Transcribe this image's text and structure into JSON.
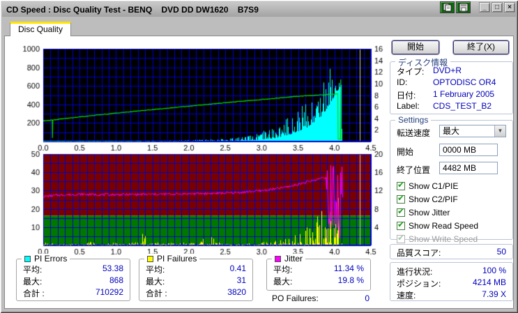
{
  "window": {
    "title": "CD Speed : Disc Quality Test - BENQ    DVD DD DW1620    B7S9"
  },
  "titlebar": {
    "min": "_",
    "max": "□",
    "close": "×"
  },
  "tab": {
    "label": "Disc Quality"
  },
  "actions": {
    "start": "開始",
    "exit": "終了(X)"
  },
  "disc_info": {
    "title": "ディスク情報",
    "rows": [
      {
        "label": "タイプ:",
        "value": "DVD+R"
      },
      {
        "label": "ID:",
        "value": "OPTODISC OR4"
      },
      {
        "label": "日付:",
        "value": "1 February 2005"
      },
      {
        "label": "Label:",
        "value": "CDS_TEST_B2"
      }
    ]
  },
  "settings": {
    "title": "Settings",
    "speed_label": "転送速度",
    "speed_value": "最大",
    "start_label": "開始",
    "start_value": "0000 MB",
    "end_label": "終了位置",
    "end_value": "4482 MB",
    "checkboxes": [
      {
        "label": "Show C1/PIE",
        "checked": true,
        "enabled": true
      },
      {
        "label": "Show C2/PIF",
        "checked": true,
        "enabled": true
      },
      {
        "label": "Show Jitter",
        "checked": true,
        "enabled": true
      },
      {
        "label": "Show Read Speed",
        "checked": true,
        "enabled": true
      },
      {
        "label": "Show Write Speed",
        "checked": true,
        "enabled": false
      }
    ]
  },
  "quality": {
    "label": "品質スコア:",
    "value": "50"
  },
  "progress": {
    "rows": [
      {
        "label": "進行状況:",
        "value": "100 %"
      },
      {
        "label": "ポジション:",
        "value": "4214 MB"
      },
      {
        "label": "速度:",
        "value": "7.39 X"
      }
    ]
  },
  "legends": [
    {
      "title": "PI Errors",
      "color": "#00ffff",
      "rows": [
        {
          "label": "平均:",
          "value": "53.38"
        },
        {
          "label": "最大:",
          "value": "868"
        },
        {
          "label": "合計 :",
          "value": "710292"
        }
      ]
    },
    {
      "title": "PI Failures",
      "color": "#ffff00",
      "rows": [
        {
          "label": "平均:",
          "value": "0.41"
        },
        {
          "label": "最大:",
          "value": "31"
        },
        {
          "label": "合計 :",
          "value": "3820"
        }
      ]
    },
    {
      "title": "Jitter",
      "color": "#ff00ff",
      "rows": [
        {
          "label": "平均:",
          "value": "11.34 %"
        },
        {
          "label": "最大:",
          "value": "19.8 %"
        }
      ]
    }
  ],
  "po_failures": {
    "label": "PO Failures:",
    "value": "0"
  },
  "chart_data": [
    {
      "type": "area",
      "title": "PI Errors / Read Speed",
      "x_range": [
        0,
        4.5
      ],
      "x_ticks": [
        "0.0",
        "0.5",
        "1.0",
        "1.5",
        "2.0",
        "2.5",
        "3.0",
        "3.5",
        "4.0",
        "4.5"
      ],
      "x_minor_step": 0.1,
      "background": "#000000",
      "grid_color": "#0000cc",
      "grid_divisions": 10,
      "left_axis": {
        "range": [
          0,
          1000
        ],
        "tick_labels": [
          "200",
          "400",
          "600",
          "800",
          "1000"
        ],
        "tick_values": [
          200,
          400,
          600,
          800,
          1000
        ]
      },
      "right_axis": {
        "range": [
          0,
          16
        ],
        "tick_labels": [
          "2",
          "4",
          "6",
          "8",
          "10",
          "12",
          "14",
          "16"
        ],
        "tick_values": [
          2,
          4,
          6,
          8,
          10,
          12,
          14,
          16
        ]
      },
      "cursor_x": 4.35,
      "cursor_color": "#c8c8c8",
      "series": [
        {
          "name": "PI Errors",
          "kind": "spikes",
          "color": "#00ffff",
          "axis": "left",
          "seed": 11,
          "base": [
            [
              0,
              1
            ],
            [
              1.0,
              2
            ],
            [
              1.5,
              3
            ],
            [
              2.0,
              5
            ],
            [
              2.5,
              8
            ],
            [
              2.8,
              12
            ],
            [
              3.0,
              20
            ],
            [
              3.2,
              40
            ],
            [
              3.4,
              80
            ],
            [
              3.6,
              140
            ],
            [
              3.8,
              260
            ],
            [
              3.9,
              360
            ],
            [
              3.95,
              430
            ],
            [
              4.0,
              500
            ],
            [
              4.05,
              560
            ],
            [
              4.09,
              600
            ],
            [
              4.1,
              0
            ]
          ],
          "peak": [
            [
              0,
              4
            ],
            [
              0.5,
              5
            ],
            [
              1.0,
              6
            ],
            [
              1.5,
              9
            ],
            [
              2.0,
              16
            ],
            [
              2.5,
              32
            ],
            [
              2.8,
              60
            ],
            [
              3.0,
              110
            ],
            [
              3.2,
              190
            ],
            [
              3.4,
              300
            ],
            [
              3.5,
              380
            ],
            [
              3.6,
              480
            ],
            [
              3.7,
              580
            ],
            [
              3.8,
              720
            ],
            [
              3.85,
              870
            ],
            [
              3.95,
              840
            ],
            [
              4.0,
              868
            ],
            [
              4.05,
              800
            ],
            [
              4.09,
              680
            ],
            [
              4.1,
              0
            ]
          ]
        },
        {
          "name": "Read Speed",
          "kind": "line",
          "color": "#00dd00",
          "axis": "right",
          "noise": 0.05,
          "seed": 4,
          "points": [
            [
              0,
              3.55
            ],
            [
              0.124,
              3.7
            ],
            [
              0.127,
              0.6
            ],
            [
              0.131,
              3.72
            ],
            [
              0.5,
              4.25
            ],
            [
              1.0,
              4.9
            ],
            [
              1.5,
              5.5
            ],
            [
              2.0,
              6.1
            ],
            [
              2.5,
              6.7
            ],
            [
              3.0,
              7.25
            ],
            [
              3.5,
              7.8
            ],
            [
              3.9,
              8.1
            ],
            [
              4.03,
              8.2
            ],
            [
              4.045,
              8.3
            ],
            [
              4.05,
              0.4
            ],
            [
              4.08,
              0.45
            ],
            [
              4.085,
              10.7
            ],
            [
              4.09,
              0.2
            ]
          ]
        }
      ]
    },
    {
      "type": "line",
      "title": "Jitter / PI Failures",
      "x_range": [
        0,
        4.5
      ],
      "x_ticks": [
        "0.0",
        "0.5",
        "1.0",
        "1.5",
        "2.0",
        "2.5",
        "3.0",
        "3.5",
        "4.0",
        "4.5"
      ],
      "x_minor_step": 0.1,
      "background_zones": [
        {
          "axis": "right",
          "from": 6.5,
          "to": 20,
          "color": "#7a0000"
        },
        {
          "axis": "right",
          "from": 0,
          "to": 6.5,
          "color": "#007800"
        }
      ],
      "grid_color": "#0000cc",
      "grid_divisions": 10,
      "left_axis": {
        "range": [
          0,
          50
        ],
        "tick_labels": [
          "10",
          "20",
          "30",
          "40",
          "50"
        ],
        "tick_values": [
          10,
          20,
          30,
          40,
          50
        ]
      },
      "right_axis": {
        "range": [
          0,
          20
        ],
        "tick_labels": [
          "4",
          "8",
          "12",
          "16",
          "20"
        ],
        "tick_values": [
          4,
          8,
          12,
          16,
          20
        ]
      },
      "cursor_x": 4.35,
      "cursor_color": "#c8c8c8",
      "series": [
        {
          "name": "PI Failures",
          "kind": "spikes",
          "color": "#ffff00",
          "axis": "left",
          "seed": 23,
          "base": [
            [
              0,
              0
            ],
            [
              4.1,
              0
            ]
          ],
          "peak": [
            [
              0,
              1.5
            ],
            [
              0.2,
              1
            ],
            [
              0.6,
              1
            ],
            [
              0.65,
              5
            ],
            [
              0.7,
              1
            ],
            [
              1.0,
              1.5
            ],
            [
              1.3,
              2
            ],
            [
              1.4,
              11
            ],
            [
              1.45,
              4
            ],
            [
              1.5,
              1.5
            ],
            [
              1.75,
              2.5
            ],
            [
              2.0,
              1.5
            ],
            [
              2.35,
              6
            ],
            [
              2.45,
              2
            ],
            [
              2.7,
              1
            ],
            [
              3.0,
              2
            ],
            [
              3.1,
              3
            ],
            [
              3.3,
              4
            ],
            [
              3.5,
              7
            ],
            [
              3.6,
              10
            ],
            [
              3.7,
              14
            ],
            [
              3.8,
              21
            ],
            [
              3.9,
              26
            ],
            [
              3.95,
              20
            ],
            [
              4.0,
              16
            ],
            [
              4.03,
              38
            ],
            [
              4.06,
              26
            ],
            [
              4.1,
              8
            ],
            [
              4.11,
              0
            ]
          ]
        },
        {
          "name": "Jitter",
          "kind": "noisyline",
          "color": "#ff00ff",
          "axis": "right",
          "noise": 0.28,
          "seed": 7,
          "points": [
            [
              0,
              10.7
            ],
            [
              0.2,
              11
            ],
            [
              0.5,
              11.2
            ],
            [
              0.8,
              11.1
            ],
            [
              1.2,
              11.15
            ],
            [
              1.6,
              11.2
            ],
            [
              2.0,
              11.3
            ],
            [
              2.4,
              11.4
            ],
            [
              2.7,
              11.6
            ],
            [
              3.0,
              12
            ],
            [
              3.2,
              12.4
            ],
            [
              3.4,
              13
            ],
            [
              3.6,
              13.8
            ],
            [
              3.75,
              14.4
            ],
            [
              3.85,
              15
            ],
            [
              3.88,
              14.8
            ]
          ],
          "chaos": {
            "from": 3.88,
            "to": 4.11,
            "min": 0.2,
            "max": 19.8
          }
        }
      ]
    }
  ]
}
